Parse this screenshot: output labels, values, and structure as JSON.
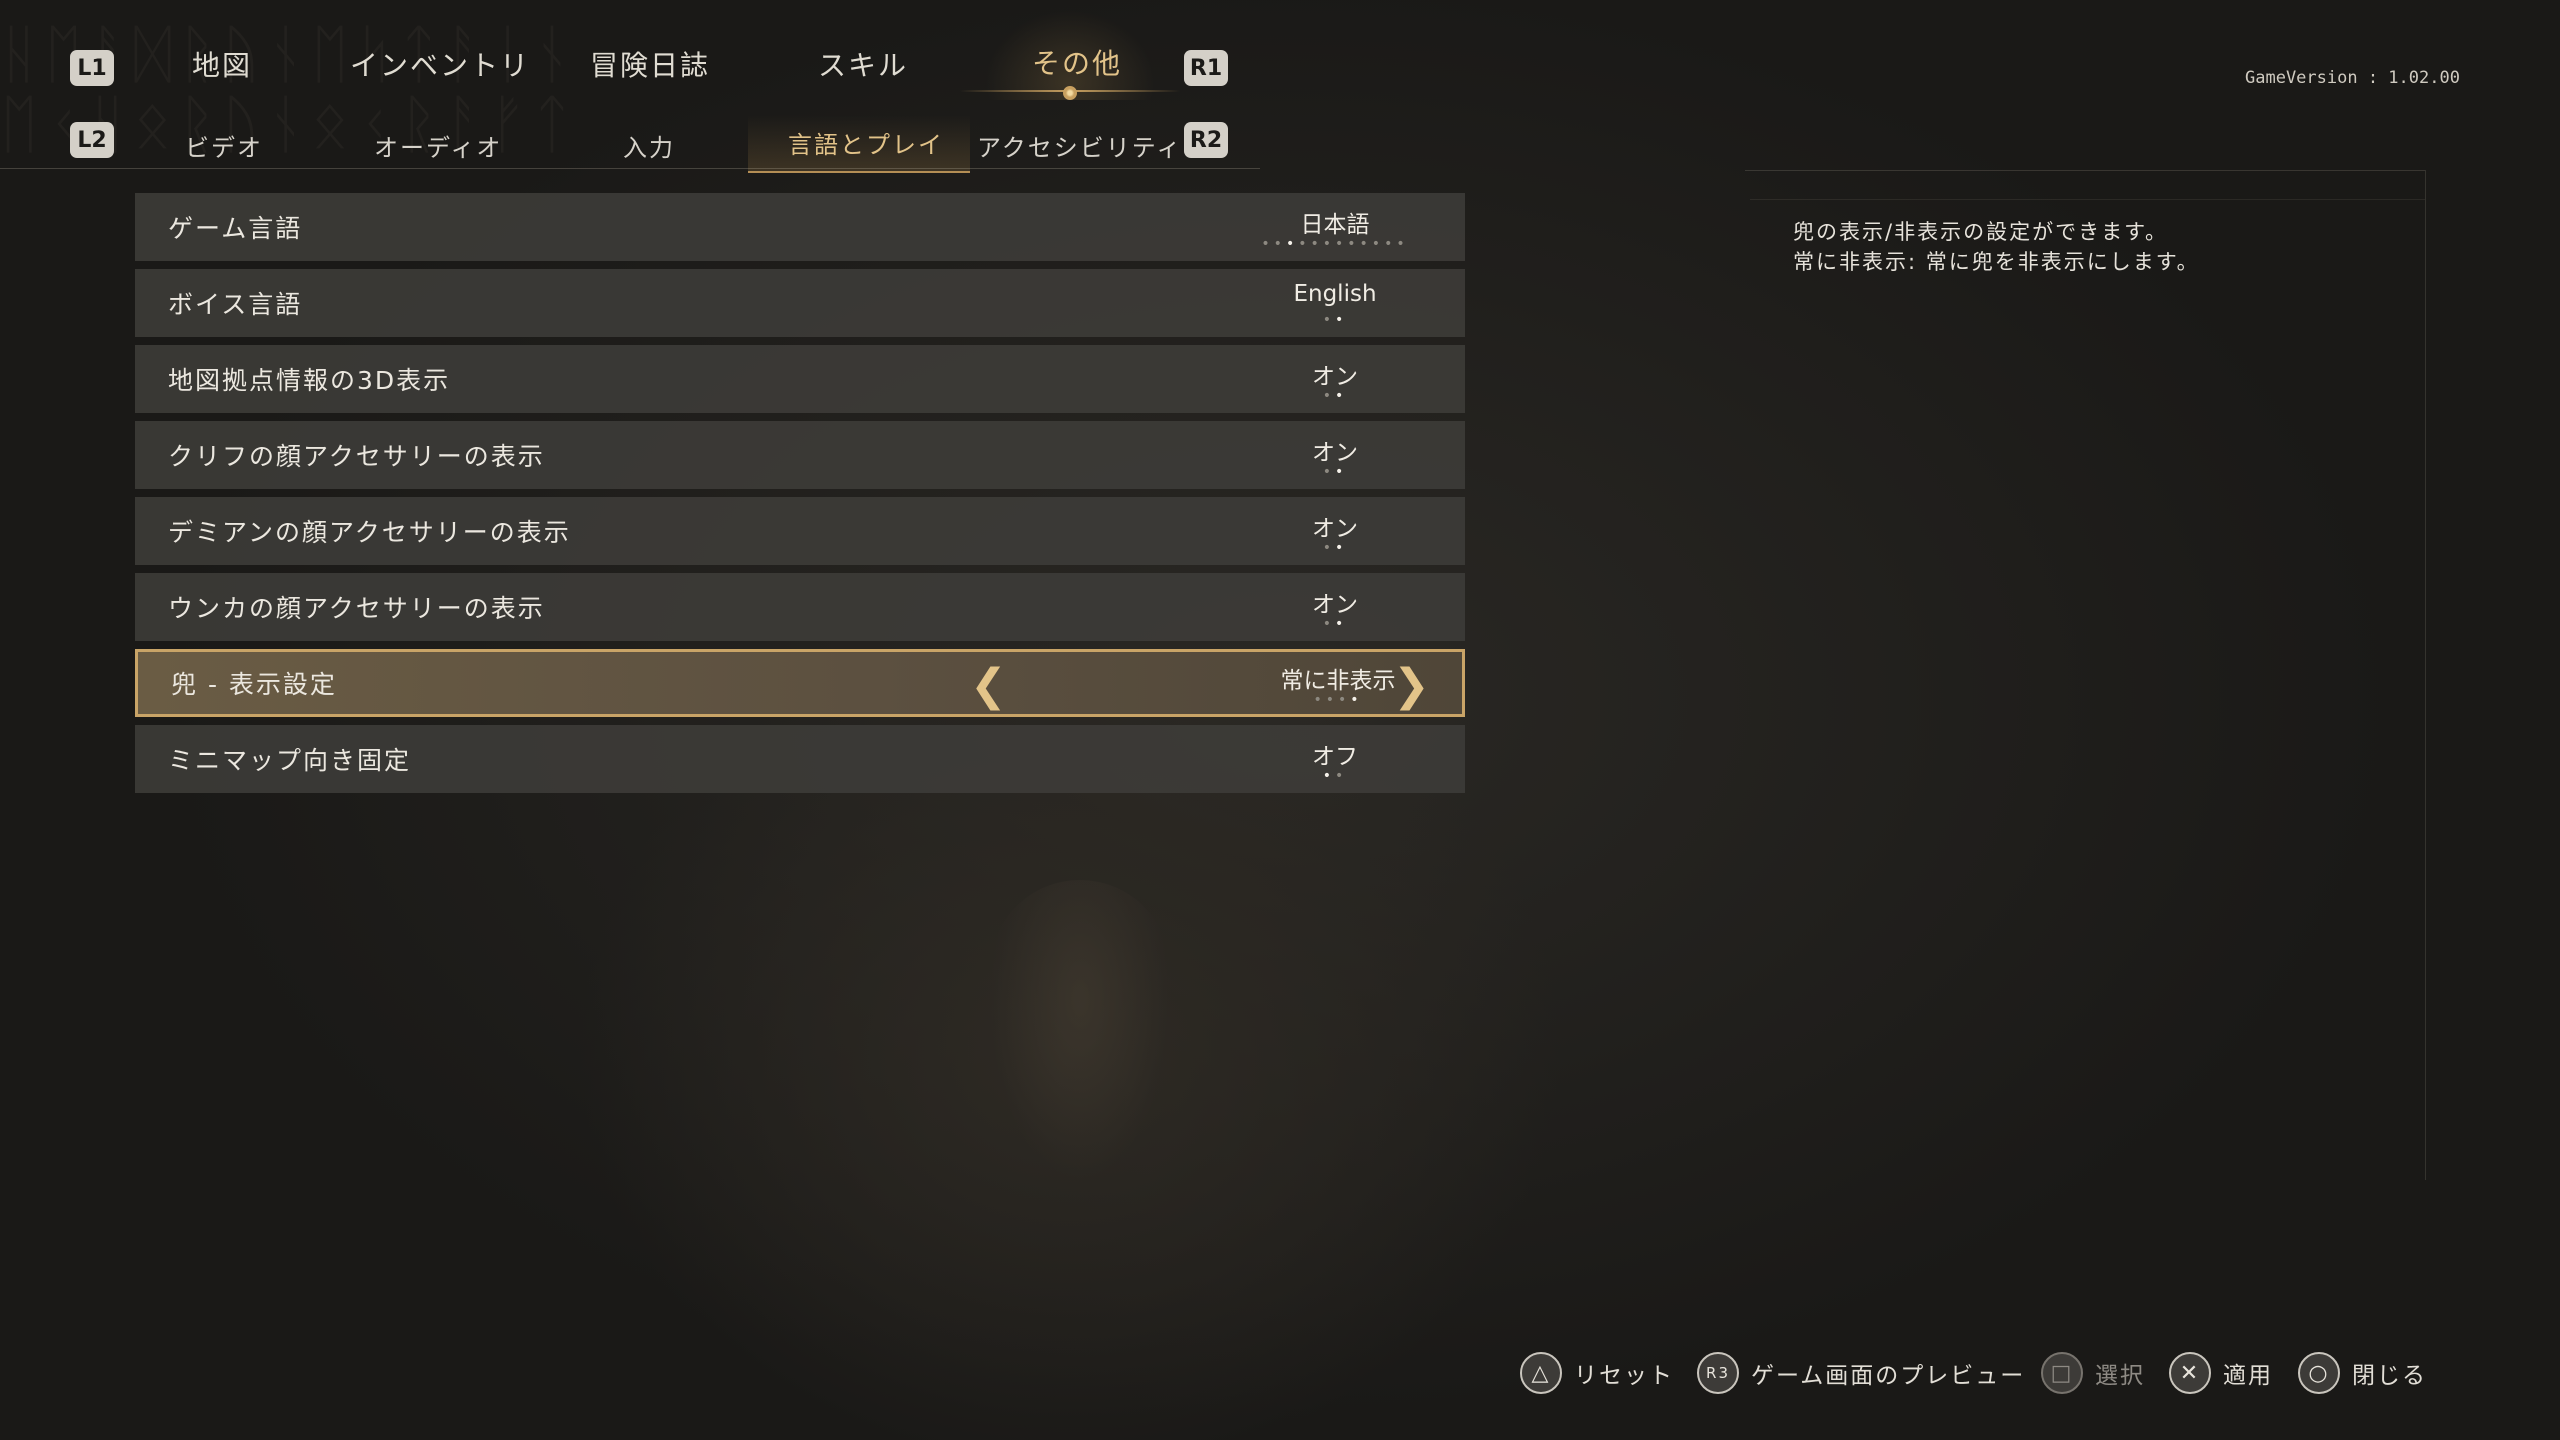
{
  "top_tabs": {
    "left_key": "L1",
    "right_key": "R1",
    "items": [
      {
        "label": "地図"
      },
      {
        "label": "インベントリ"
      },
      {
        "label": "冒険日誌"
      },
      {
        "label": "スキル"
      },
      {
        "label": "その他",
        "active": true
      }
    ]
  },
  "sub_tabs": {
    "left_key": "L2",
    "right_key": "R2",
    "items": [
      {
        "label": "ビデオ"
      },
      {
        "label": "オーディオ"
      },
      {
        "label": "入力"
      },
      {
        "label": "言語とプレイ",
        "active": true
      },
      {
        "label": "アクセシビリティ"
      }
    ]
  },
  "version": "GameVersion : 1.02.00",
  "settings": [
    {
      "label": "ゲーム言語",
      "value": "日本語",
      "options_count": 12,
      "selected_index": 2
    },
    {
      "label": "ボイス言語",
      "value": "English",
      "options_count": 2,
      "selected_index": 1
    },
    {
      "label": "地図拠点情報の3D表示",
      "value": "オン",
      "options_count": 2,
      "selected_index": 1
    },
    {
      "label": "クリフの顔アクセサリーの表示",
      "value": "オン",
      "options_count": 2,
      "selected_index": 1
    },
    {
      "label": "デミアンの顔アクセサリーの表示",
      "value": "オン",
      "options_count": 2,
      "selected_index": 1
    },
    {
      "label": "ウンカの顔アクセサリーの表示",
      "value": "オン",
      "options_count": 2,
      "selected_index": 1
    },
    {
      "label": "兜 - 表示設定",
      "value": "常に非表示",
      "options_count": 4,
      "selected_index": 3,
      "selected": true
    },
    {
      "label": "ミニマップ向き固定",
      "value": "オフ",
      "options_count": 2,
      "selected_index": 0
    }
  ],
  "description": {
    "line1": "兜の表示/非表示の設定ができます。",
    "line2": "常に非表示: 常に兜を非表示にします。"
  },
  "hints": [
    {
      "icon": "triangle-icon",
      "glyph": "△",
      "label": "リセット"
    },
    {
      "icon": "r3-icon",
      "glyph": "R3",
      "label": "ゲーム画面のプレビュー"
    },
    {
      "icon": "square-icon",
      "glyph": "□",
      "label": "選択",
      "disabled": true
    },
    {
      "icon": "cross-icon",
      "glyph": "✕",
      "label": "適用"
    },
    {
      "icon": "circle-icon",
      "glyph": "○",
      "label": "閉じる"
    }
  ],
  "colors": {
    "accent_gold": "#c9a467",
    "active_text": "#e2c389",
    "row_bg": "#3e3c39"
  }
}
